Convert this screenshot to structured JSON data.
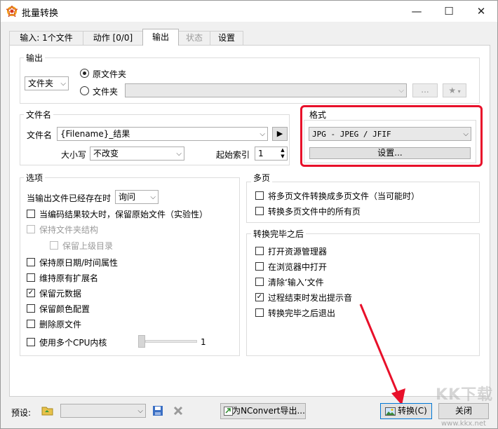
{
  "window": {
    "title": "批量转换",
    "minimize": "—",
    "maximize": "☐",
    "close": "✕"
  },
  "tabs": [
    {
      "label": "输入: 1个文件"
    },
    {
      "label": "动作 [0/0]"
    },
    {
      "label": "输出"
    },
    {
      "label": "状态"
    },
    {
      "label": "设置"
    }
  ],
  "output": {
    "group_title": "输出",
    "folder_type": "文件夹",
    "radio_original": "原文件夹",
    "radio_folder": "文件夹",
    "folder_path": "",
    "browse": "...",
    "star": "★"
  },
  "filename": {
    "group_title": "文件名",
    "label": "文件名",
    "value": "{Filename}_结果",
    "play": "▶",
    "case_label": "大小写",
    "case_value": "不改变",
    "start_index_label": "起始索引",
    "start_index_value": "1"
  },
  "format": {
    "group_title": "格式",
    "value": "JPG - JPEG / JFIF",
    "settings": "设置..."
  },
  "options": {
    "group_title": "选项",
    "exists_label": "当输出文件已经存在时",
    "exists_value": "询问",
    "items": [
      {
        "label": "当编码结果较大时，保留原始文件（实验性）",
        "checked": false,
        "disabled": false
      },
      {
        "label": "保持文件夹结构",
        "checked": false,
        "disabled": true
      },
      {
        "label": "保留上级目录",
        "checked": false,
        "disabled": true
      },
      {
        "label": "保持原日期/时间属性",
        "checked": false,
        "disabled": false
      },
      {
        "label": "维持原有扩展名",
        "checked": false,
        "disabled": false
      },
      {
        "label": "保留元数据",
        "checked": true,
        "disabled": false
      },
      {
        "label": "保留颜色配置",
        "checked": false,
        "disabled": false
      },
      {
        "label": "删除原文件",
        "checked": false,
        "disabled": false
      },
      {
        "label": "使用多个CPU内核",
        "checked": false,
        "disabled": false
      }
    ],
    "cpu_cores": "1",
    "cpu_slider_fraction": 0
  },
  "multipage": {
    "group_title": "多页",
    "items": [
      {
        "label": "将多页文件转换成多页文件（当可能时）",
        "checked": false
      },
      {
        "label": "转换多页文件中的所有页",
        "checked": false
      }
    ]
  },
  "after": {
    "group_title": "转换完毕之后",
    "items": [
      {
        "label": "打开资源管理器",
        "checked": false
      },
      {
        "label": "在浏览器中打开",
        "checked": false
      },
      {
        "label": "清除‘输入’文件",
        "checked": false
      },
      {
        "label": "过程结束时发出提示音",
        "checked": true
      },
      {
        "label": "转换完毕之后退出",
        "checked": false
      }
    ]
  },
  "bottom": {
    "preset_label": "预设:",
    "preset_value": "",
    "export": "为NConvert导出...",
    "convert": "转换(C)",
    "close": "关闭"
  },
  "watermark": {
    "text": "KK下载",
    "url": "www.kkx.net"
  },
  "colors": {
    "highlight": "#e8102a",
    "arrow": "#e8102a"
  }
}
